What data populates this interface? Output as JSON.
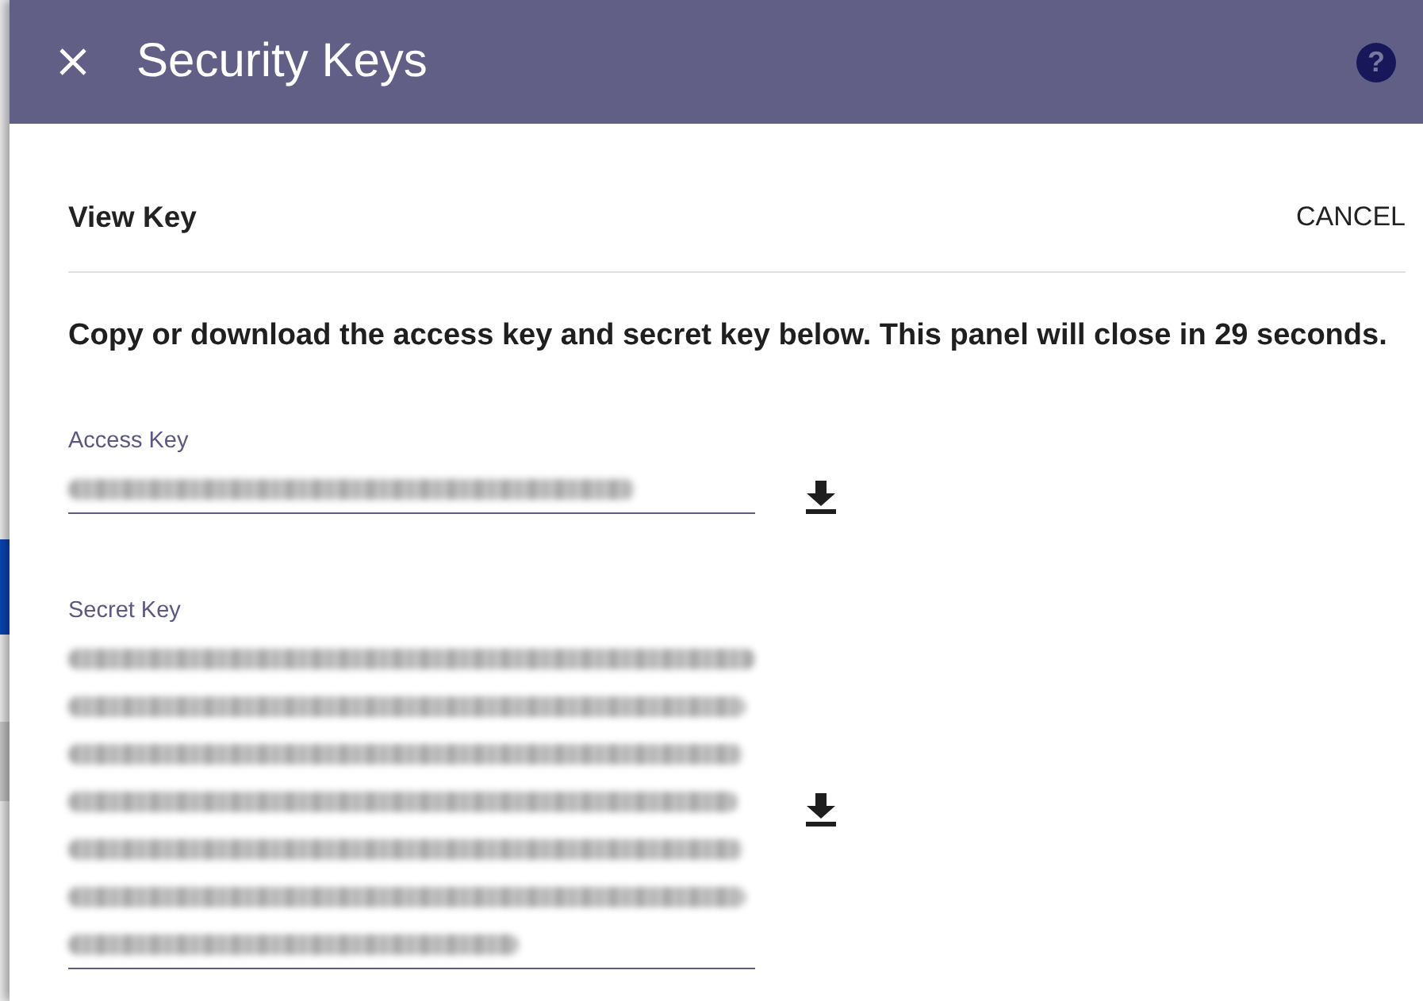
{
  "header": {
    "title": "Security Keys",
    "help": "?"
  },
  "form": {
    "heading": "View Key",
    "cancel": "CANCEL"
  },
  "notice": "Copy or download the access key and secret key below. This panel will close in 29 seconds.",
  "keys": [
    {
      "label": "Access Key",
      "kind": "single_line"
    },
    {
      "label": "Secret Key",
      "kind": "multi_line"
    }
  ]
}
